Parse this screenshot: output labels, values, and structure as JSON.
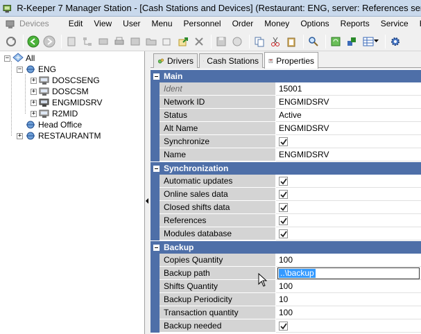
{
  "window": {
    "title": "R-Keeper 7 Manager Station - [Cash Stations and Devices] (Restaurant: ENG, server: References server) - [Cash"
  },
  "menu": {
    "devices": "Devices",
    "items": [
      "Edit",
      "View",
      "User",
      "Menu",
      "Personnel",
      "Order",
      "Money",
      "Options",
      "Reports",
      "Service",
      "Help"
    ]
  },
  "tree": {
    "root": "All",
    "eng": "ENG",
    "children": [
      "DOSCSENG",
      "DOSCSM",
      "ENGMIDSRV",
      "R2MID"
    ],
    "head_office": "Head Office",
    "restaurantm": "RESTAURANTM"
  },
  "tabs": [
    "Drivers",
    "Cash Stations",
    "Properties"
  ],
  "properties": {
    "main": {
      "header": "Main",
      "rows": [
        {
          "name": "Ident",
          "value": "15001"
        },
        {
          "name": "Network ID",
          "value": "ENGMIDSRV"
        },
        {
          "name": "Status",
          "value": "Active"
        },
        {
          "name": "Alt Name",
          "value": "ENGMIDSRV"
        },
        {
          "name": "Synchronize",
          "value": ""
        },
        {
          "name": "Name",
          "value": "ENGMIDSRV"
        }
      ]
    },
    "sync": {
      "header": "Synchronization",
      "rows": [
        {
          "name": "Automatic updates"
        },
        {
          "name": "Online sales data"
        },
        {
          "name": "Closed shifts data"
        },
        {
          "name": "References"
        },
        {
          "name": "Modules database"
        }
      ]
    },
    "backup": {
      "header": "Backup",
      "rows": [
        {
          "name": "Copies Quantity",
          "value": "100"
        },
        {
          "name": "Backup path",
          "value": "..\\backup"
        },
        {
          "name": "Shifts Quantity",
          "value": "100"
        },
        {
          "name": "Backup Periodicity",
          "value": "10"
        },
        {
          "name": "Transaction quantity",
          "value": "100"
        },
        {
          "name": "Backup needed",
          "value": ""
        }
      ]
    }
  }
}
